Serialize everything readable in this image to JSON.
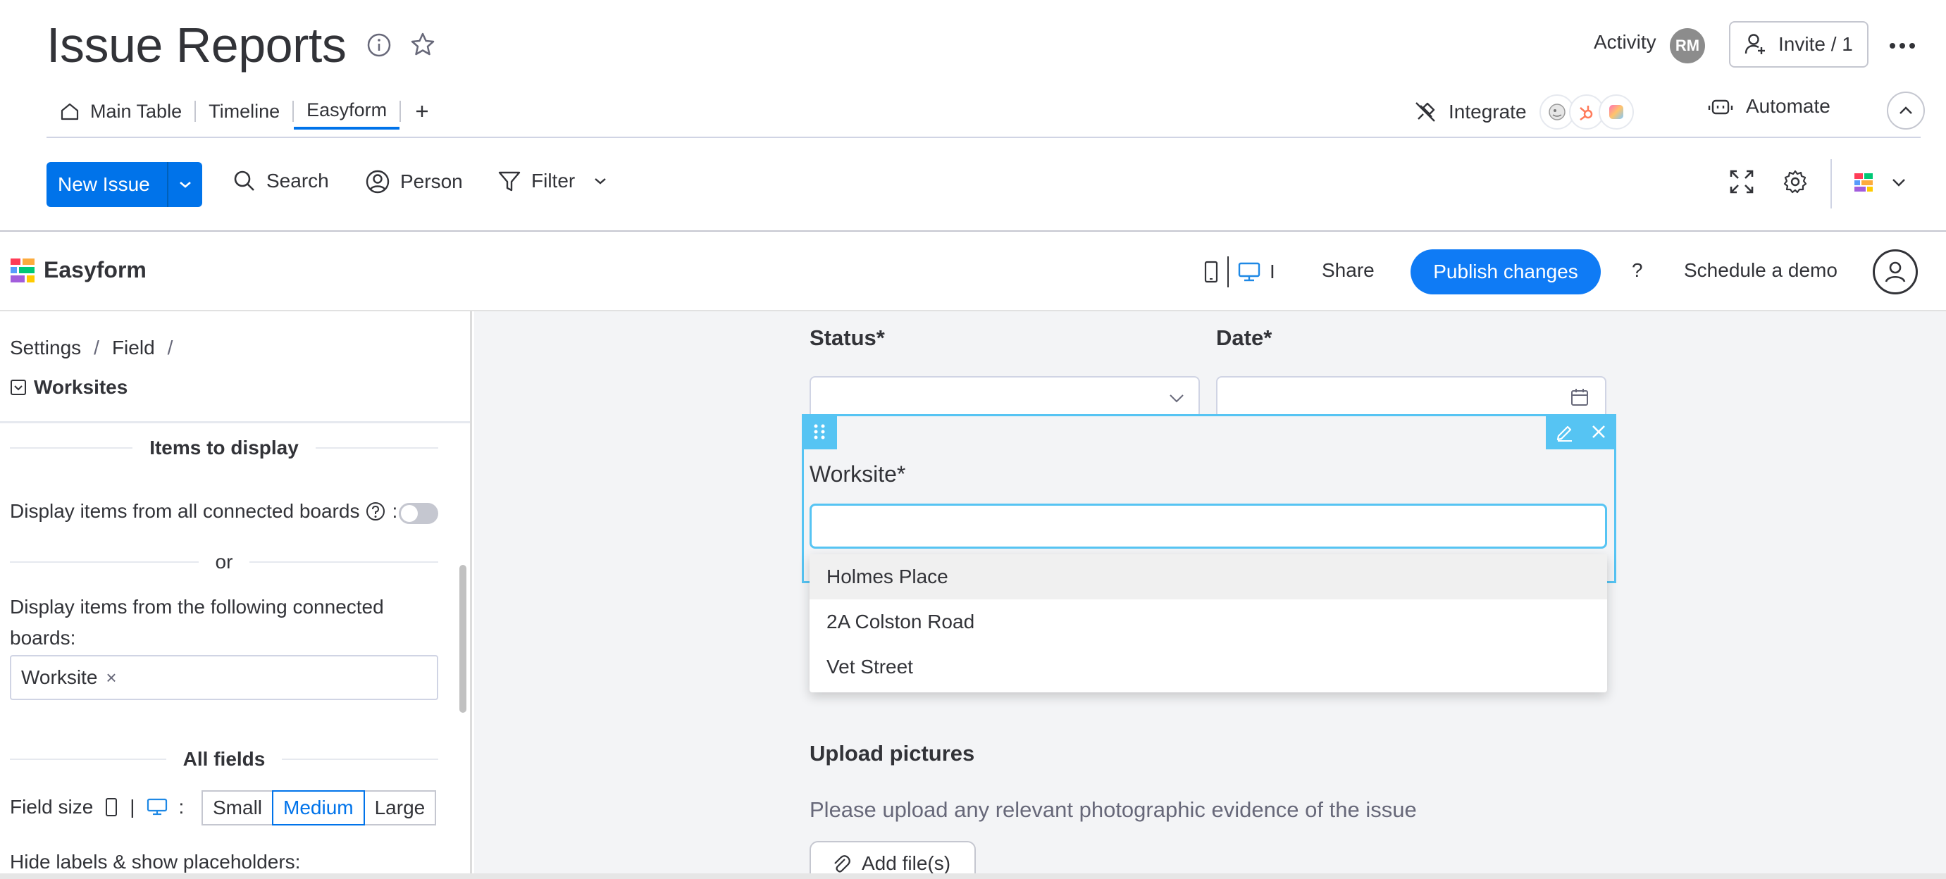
{
  "header": {
    "title": "Issue Reports",
    "activity_label": "Activity",
    "avatar_initials": "RM",
    "invite_label": "Invite / 1"
  },
  "tabs": [
    {
      "label": "Main Table"
    },
    {
      "label": "Timeline"
    },
    {
      "label": "Easyform"
    }
  ],
  "integrations": {
    "integrate_label": "Integrate",
    "automate_label": "Automate"
  },
  "toolbar": {
    "new_item_label": "New Issue",
    "search_label": "Search",
    "person_label": "Person",
    "filter_label": "Filter"
  },
  "easyform_bar": {
    "app_name": "Easyform",
    "device_text": "I",
    "share_label": "Share",
    "publish_label": "Publish changes",
    "help_label": "?",
    "schedule_label": "Schedule a demo"
  },
  "left_panel": {
    "breadcrumb": [
      "Settings",
      "Field"
    ],
    "breadcrumb_sep": "/",
    "field_name": "Worksites",
    "items_to_display_header": "Items to display",
    "display_all_label": "Display items from all connected boards",
    "display_all_suffix": ":",
    "or_label": "or",
    "display_following_label": "Display items from the following connected boards:",
    "selected_board": "Worksite",
    "tag_remove": "×",
    "all_fields_header": "All fields",
    "field_size_label": "Field size",
    "field_size_suffix": ":",
    "field_size_options": [
      "Small",
      "Medium",
      "Large"
    ],
    "field_size_selected": "Medium",
    "hide_labels_label": "Hide labels & show placeholders:",
    "display_all_enabled": false,
    "hide_labels_enabled": false
  },
  "form": {
    "status_label": "Status*",
    "date_label": "Date*",
    "worksite_label": "Worksite*",
    "worksite_value": "",
    "worksite_options": [
      "Holmes Place",
      "2A Colston Road",
      "Vet Street"
    ],
    "upload_label": "Upload pictures",
    "upload_description": "Please upload any relevant photographic evidence of the issue",
    "add_files_label": "Add file(s)"
  },
  "colors": {
    "primary": "#0073ea",
    "publish": "#0f7bf5",
    "selection": "#56c4f3"
  }
}
